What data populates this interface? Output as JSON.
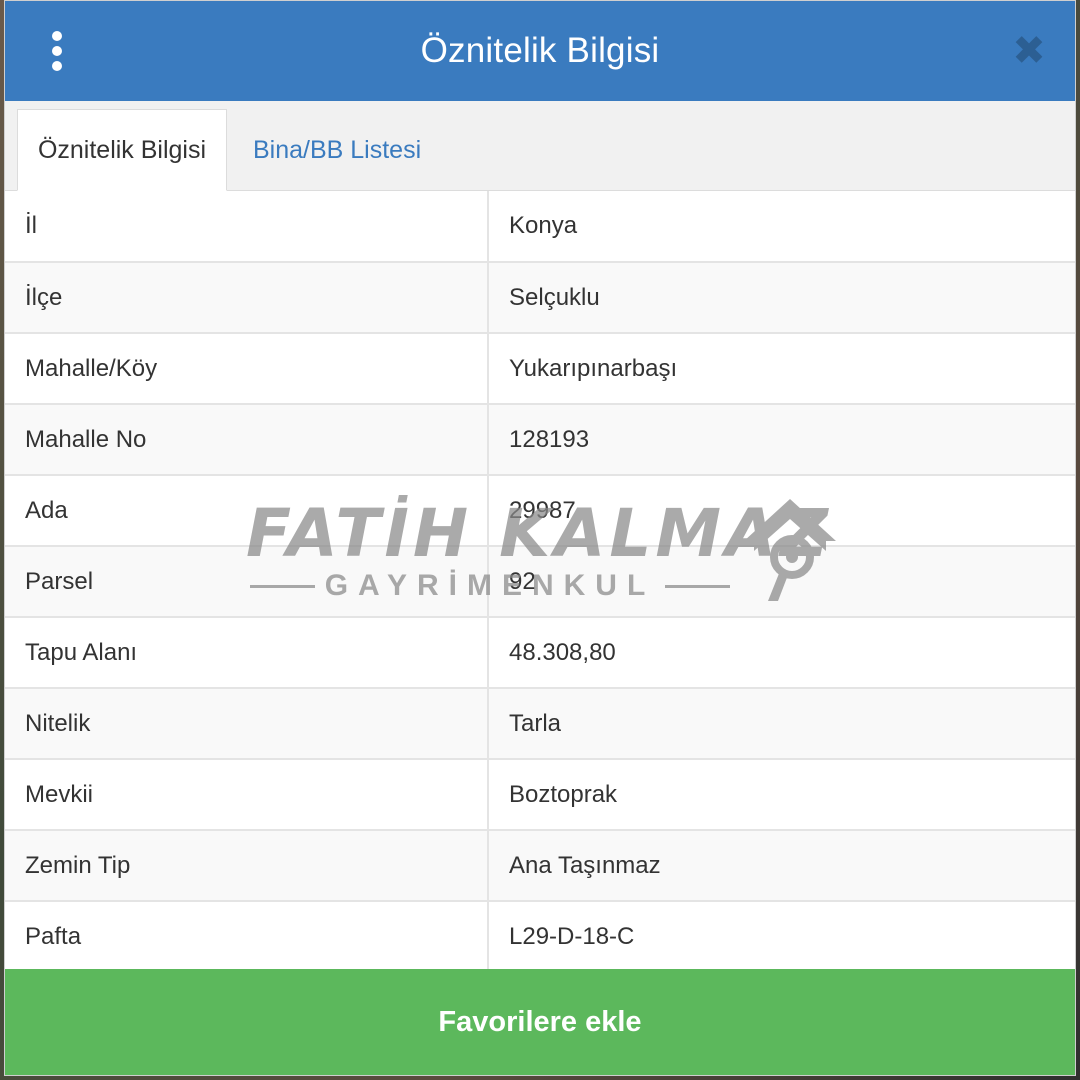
{
  "header": {
    "title": "Öznitelik Bilgisi",
    "menu_icon": "vertical-dots-icon",
    "close_icon": "close-icon",
    "close_glyph": "✖"
  },
  "tabs": [
    {
      "label": "Öznitelik Bilgisi",
      "active": true
    },
    {
      "label": "Bina/BB Listesi",
      "active": false
    }
  ],
  "attributes": [
    {
      "key": "İl",
      "value": "Konya"
    },
    {
      "key": "İlçe",
      "value": "Selçuklu"
    },
    {
      "key": "Mahalle/Köy",
      "value": "Yukarıpınarbaşı"
    },
    {
      "key": "Mahalle No",
      "value": "128193"
    },
    {
      "key": "Ada",
      "value": "29987"
    },
    {
      "key": "Parsel",
      "value": "92"
    },
    {
      "key": "Tapu Alanı",
      "value": "48.308,80"
    },
    {
      "key": "Nitelik",
      "value": "Tarla"
    },
    {
      "key": "Mevkii",
      "value": "Boztoprak"
    },
    {
      "key": "Zemin Tip",
      "value": "Ana Taşınmaz"
    },
    {
      "key": "Pafta",
      "value": "L29-D-18-C"
    }
  ],
  "watermark": {
    "name": "FATİH KALMAZ",
    "subtitle": "GAYRİMENKUL"
  },
  "footer": {
    "button_label": "Favorilere ekle"
  },
  "colors": {
    "header": "#3a7bbf",
    "footer": "#5cb85c",
    "link": "#3a7bbf"
  }
}
